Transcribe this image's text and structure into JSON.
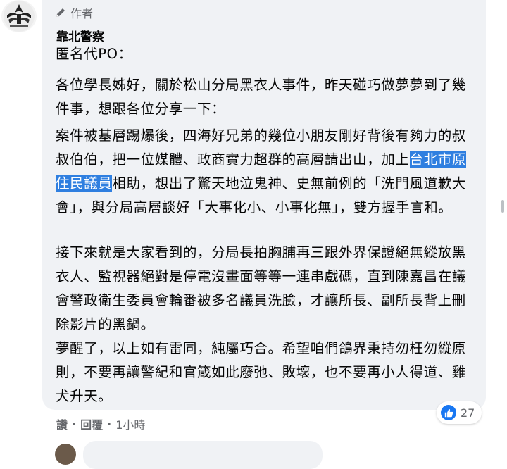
{
  "comment": {
    "role_label": "作者",
    "author_name": "靠北警察",
    "paragraphs": [
      "匿名代PO：",
      "各位學長姊好，關於松山分局黑衣人事件，昨天碰巧做夢夢到了幾件事，想跟各位分享一下：",
      "案件被基層踢爆後，四海好兄弟的幾位小朋友剛好背後有夠力的叔叔伯伯，把一位媒體、政商實力超群的高層請出山，加上",
      "台北市原住民議員",
      "相助，想出了驚天地泣鬼神、史無前例的「洗門風道歉大會」，與分局高層談好「大事化小、小事化無」，雙方握手言和。",
      "接下來就是大家看到的，分局長拍胸脯再三跟外界保證絕無縱放黑衣人、監視器絕對是停電沒畫面等等一連串戲碼，直到陳嘉昌在議會警政衛生委員會輪番被多名議員洗臉，才讓所長、副所長背上刪除影片的黑鍋。",
      "夢醒了，以上如有雷同，純屬巧合。希望咱們鴿界秉持勿枉勿縱原則，不要再讓警紀和官箴如此廢弛、敗壞，也不要再小人得道、雞犬升天。"
    ],
    "reaction_count": "27",
    "actions": {
      "like": "讚",
      "reply": "回覆",
      "time": "1小時"
    }
  },
  "colors": {
    "bubble": "#f0f2f5",
    "highlight": "#2f7fe0",
    "like_blue": "#1877f2",
    "muted_text": "#65676b"
  },
  "icons": {
    "role": "pencil-icon",
    "reaction": "thumbs-up-icon"
  }
}
